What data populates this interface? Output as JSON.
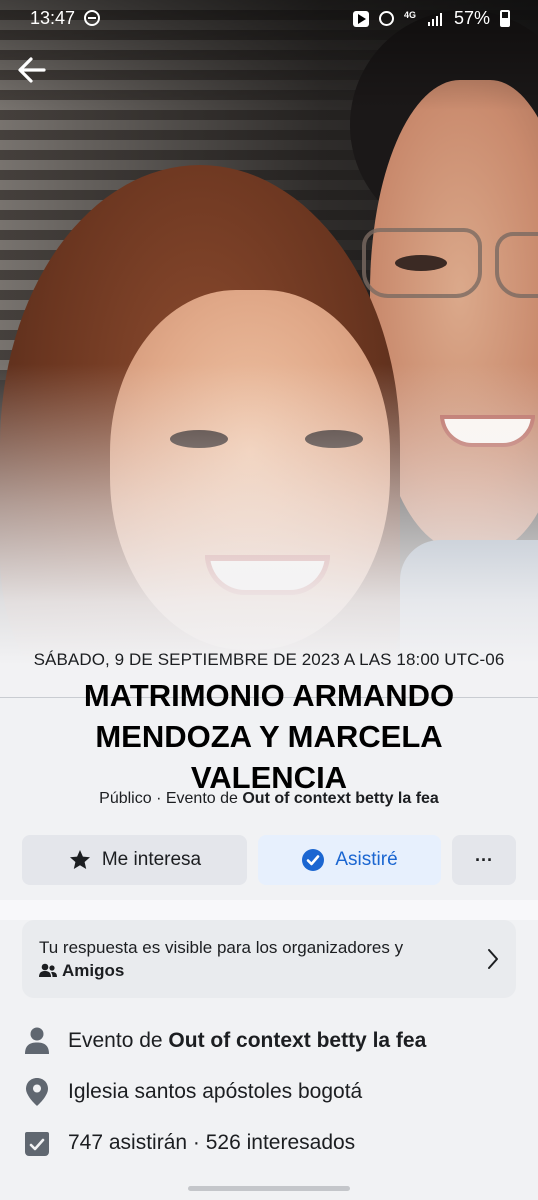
{
  "status_bar": {
    "time": "13:47",
    "network": "4G",
    "battery": "57%"
  },
  "event": {
    "date": "SÁBADO, 9 DE SEPTIEMBRE DE 2023 A LAS 18:00 UTC-06",
    "title": "MATRIMONIO ARMANDO MENDOZA Y MARCELA VALENCIA",
    "privacy": "Público · Evento de ",
    "host": "Out of context betty la fea"
  },
  "actions": {
    "interested_label": "Me interesa",
    "going_label": "Asistiré",
    "more_label": "···"
  },
  "visibility_card": {
    "text": "Tu respuesta es visible para los organizadores y",
    "audience": "Amigos"
  },
  "details": {
    "host_prefix": "Evento de ",
    "host_name": "Out of context betty la fea",
    "location": "Iglesia santos apóstoles bogotá",
    "attendance": "747 asistirán · 526 interesados"
  },
  "colors": {
    "accent_blue": "#1b66d1",
    "going_bg": "#e7f0fd",
    "button_gray": "#e4e6eb",
    "page_bg": "#f1f2f4"
  },
  "icons": {
    "back": "arrow-left-icon",
    "star": "star-icon",
    "check": "check-circle-icon",
    "friends": "friends-icon",
    "chevron": "chevron-right-icon",
    "person": "person-icon",
    "pin": "location-pin-icon",
    "calendar_check": "calendar-check-icon"
  }
}
